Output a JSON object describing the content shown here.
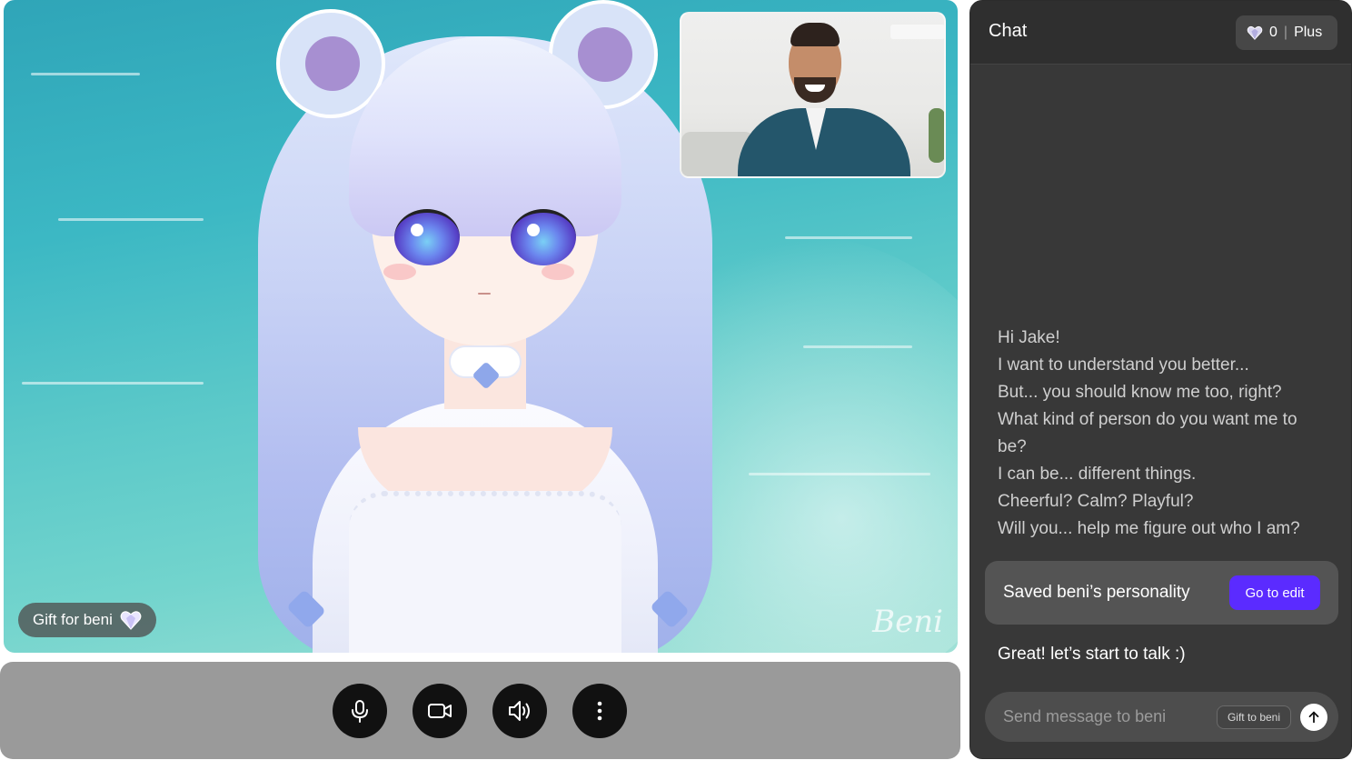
{
  "stage": {
    "gift_label": "Gift for beni",
    "gift_icon": "diamond-heart-icon",
    "watermark": "Beni"
  },
  "controls": [
    {
      "name": "microphone",
      "icon": "microphone-icon"
    },
    {
      "name": "camera",
      "icon": "video-camera-icon"
    },
    {
      "name": "speaker",
      "icon": "speaker-icon"
    },
    {
      "name": "more",
      "icon": "more-vertical-icon"
    }
  ],
  "chat": {
    "title": "Chat",
    "gem_count": "0",
    "separator": "|",
    "plan": "Plus",
    "messages": [
      "Hi Jake!",
      "I want to understand you better...",
      "But... you should know me too, right?",
      "What kind of person do you want me to",
      "be?",
      "I can be... different things.",
      "Cheerful? Calm? Playful?",
      "Will you... help me figure out who I am?"
    ],
    "saved_card": {
      "text": "Saved beni’s personality",
      "button": "Go to edit"
    },
    "reply": "Great! let’s start to talk :)",
    "composer": {
      "placeholder": "Send message to beni",
      "gift_chip": "Gift to beni",
      "send_icon": "arrow-up-icon"
    }
  },
  "colors": {
    "accent": "#5b2bff",
    "panel": "#383838",
    "control_bar": "#9a9a9a"
  }
}
